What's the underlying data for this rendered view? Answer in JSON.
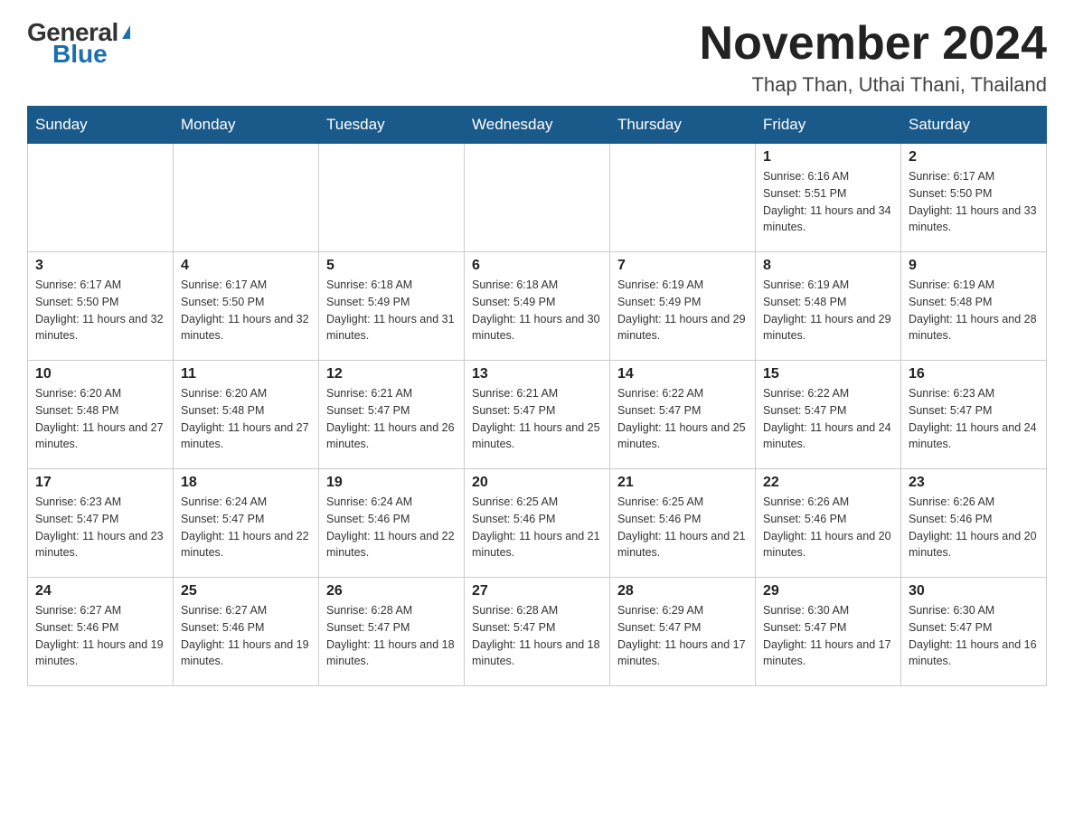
{
  "header": {
    "logo": {
      "general": "General",
      "blue": "Blue"
    },
    "title": "November 2024",
    "location": "Thap Than, Uthai Thani, Thailand"
  },
  "calendar": {
    "days_of_week": [
      "Sunday",
      "Monday",
      "Tuesday",
      "Wednesday",
      "Thursday",
      "Friday",
      "Saturday"
    ],
    "weeks": [
      [
        {
          "day": "",
          "sunrise": "",
          "sunset": "",
          "daylight": ""
        },
        {
          "day": "",
          "sunrise": "",
          "sunset": "",
          "daylight": ""
        },
        {
          "day": "",
          "sunrise": "",
          "sunset": "",
          "daylight": ""
        },
        {
          "day": "",
          "sunrise": "",
          "sunset": "",
          "daylight": ""
        },
        {
          "day": "",
          "sunrise": "",
          "sunset": "",
          "daylight": ""
        },
        {
          "day": "1",
          "sunrise": "Sunrise: 6:16 AM",
          "sunset": "Sunset: 5:51 PM",
          "daylight": "Daylight: 11 hours and 34 minutes."
        },
        {
          "day": "2",
          "sunrise": "Sunrise: 6:17 AM",
          "sunset": "Sunset: 5:50 PM",
          "daylight": "Daylight: 11 hours and 33 minutes."
        }
      ],
      [
        {
          "day": "3",
          "sunrise": "Sunrise: 6:17 AM",
          "sunset": "Sunset: 5:50 PM",
          "daylight": "Daylight: 11 hours and 32 minutes."
        },
        {
          "day": "4",
          "sunrise": "Sunrise: 6:17 AM",
          "sunset": "Sunset: 5:50 PM",
          "daylight": "Daylight: 11 hours and 32 minutes."
        },
        {
          "day": "5",
          "sunrise": "Sunrise: 6:18 AM",
          "sunset": "Sunset: 5:49 PM",
          "daylight": "Daylight: 11 hours and 31 minutes."
        },
        {
          "day": "6",
          "sunrise": "Sunrise: 6:18 AM",
          "sunset": "Sunset: 5:49 PM",
          "daylight": "Daylight: 11 hours and 30 minutes."
        },
        {
          "day": "7",
          "sunrise": "Sunrise: 6:19 AM",
          "sunset": "Sunset: 5:49 PM",
          "daylight": "Daylight: 11 hours and 29 minutes."
        },
        {
          "day": "8",
          "sunrise": "Sunrise: 6:19 AM",
          "sunset": "Sunset: 5:48 PM",
          "daylight": "Daylight: 11 hours and 29 minutes."
        },
        {
          "day": "9",
          "sunrise": "Sunrise: 6:19 AM",
          "sunset": "Sunset: 5:48 PM",
          "daylight": "Daylight: 11 hours and 28 minutes."
        }
      ],
      [
        {
          "day": "10",
          "sunrise": "Sunrise: 6:20 AM",
          "sunset": "Sunset: 5:48 PM",
          "daylight": "Daylight: 11 hours and 27 minutes."
        },
        {
          "day": "11",
          "sunrise": "Sunrise: 6:20 AM",
          "sunset": "Sunset: 5:48 PM",
          "daylight": "Daylight: 11 hours and 27 minutes."
        },
        {
          "day": "12",
          "sunrise": "Sunrise: 6:21 AM",
          "sunset": "Sunset: 5:47 PM",
          "daylight": "Daylight: 11 hours and 26 minutes."
        },
        {
          "day": "13",
          "sunrise": "Sunrise: 6:21 AM",
          "sunset": "Sunset: 5:47 PM",
          "daylight": "Daylight: 11 hours and 25 minutes."
        },
        {
          "day": "14",
          "sunrise": "Sunrise: 6:22 AM",
          "sunset": "Sunset: 5:47 PM",
          "daylight": "Daylight: 11 hours and 25 minutes."
        },
        {
          "day": "15",
          "sunrise": "Sunrise: 6:22 AM",
          "sunset": "Sunset: 5:47 PM",
          "daylight": "Daylight: 11 hours and 24 minutes."
        },
        {
          "day": "16",
          "sunrise": "Sunrise: 6:23 AM",
          "sunset": "Sunset: 5:47 PM",
          "daylight": "Daylight: 11 hours and 24 minutes."
        }
      ],
      [
        {
          "day": "17",
          "sunrise": "Sunrise: 6:23 AM",
          "sunset": "Sunset: 5:47 PM",
          "daylight": "Daylight: 11 hours and 23 minutes."
        },
        {
          "day": "18",
          "sunrise": "Sunrise: 6:24 AM",
          "sunset": "Sunset: 5:47 PM",
          "daylight": "Daylight: 11 hours and 22 minutes."
        },
        {
          "day": "19",
          "sunrise": "Sunrise: 6:24 AM",
          "sunset": "Sunset: 5:46 PM",
          "daylight": "Daylight: 11 hours and 22 minutes."
        },
        {
          "day": "20",
          "sunrise": "Sunrise: 6:25 AM",
          "sunset": "Sunset: 5:46 PM",
          "daylight": "Daylight: 11 hours and 21 minutes."
        },
        {
          "day": "21",
          "sunrise": "Sunrise: 6:25 AM",
          "sunset": "Sunset: 5:46 PM",
          "daylight": "Daylight: 11 hours and 21 minutes."
        },
        {
          "day": "22",
          "sunrise": "Sunrise: 6:26 AM",
          "sunset": "Sunset: 5:46 PM",
          "daylight": "Daylight: 11 hours and 20 minutes."
        },
        {
          "day": "23",
          "sunrise": "Sunrise: 6:26 AM",
          "sunset": "Sunset: 5:46 PM",
          "daylight": "Daylight: 11 hours and 20 minutes."
        }
      ],
      [
        {
          "day": "24",
          "sunrise": "Sunrise: 6:27 AM",
          "sunset": "Sunset: 5:46 PM",
          "daylight": "Daylight: 11 hours and 19 minutes."
        },
        {
          "day": "25",
          "sunrise": "Sunrise: 6:27 AM",
          "sunset": "Sunset: 5:46 PM",
          "daylight": "Daylight: 11 hours and 19 minutes."
        },
        {
          "day": "26",
          "sunrise": "Sunrise: 6:28 AM",
          "sunset": "Sunset: 5:47 PM",
          "daylight": "Daylight: 11 hours and 18 minutes."
        },
        {
          "day": "27",
          "sunrise": "Sunrise: 6:28 AM",
          "sunset": "Sunset: 5:47 PM",
          "daylight": "Daylight: 11 hours and 18 minutes."
        },
        {
          "day": "28",
          "sunrise": "Sunrise: 6:29 AM",
          "sunset": "Sunset: 5:47 PM",
          "daylight": "Daylight: 11 hours and 17 minutes."
        },
        {
          "day": "29",
          "sunrise": "Sunrise: 6:30 AM",
          "sunset": "Sunset: 5:47 PM",
          "daylight": "Daylight: 11 hours and 17 minutes."
        },
        {
          "day": "30",
          "sunrise": "Sunrise: 6:30 AM",
          "sunset": "Sunset: 5:47 PM",
          "daylight": "Daylight: 11 hours and 16 minutes."
        }
      ]
    ]
  }
}
